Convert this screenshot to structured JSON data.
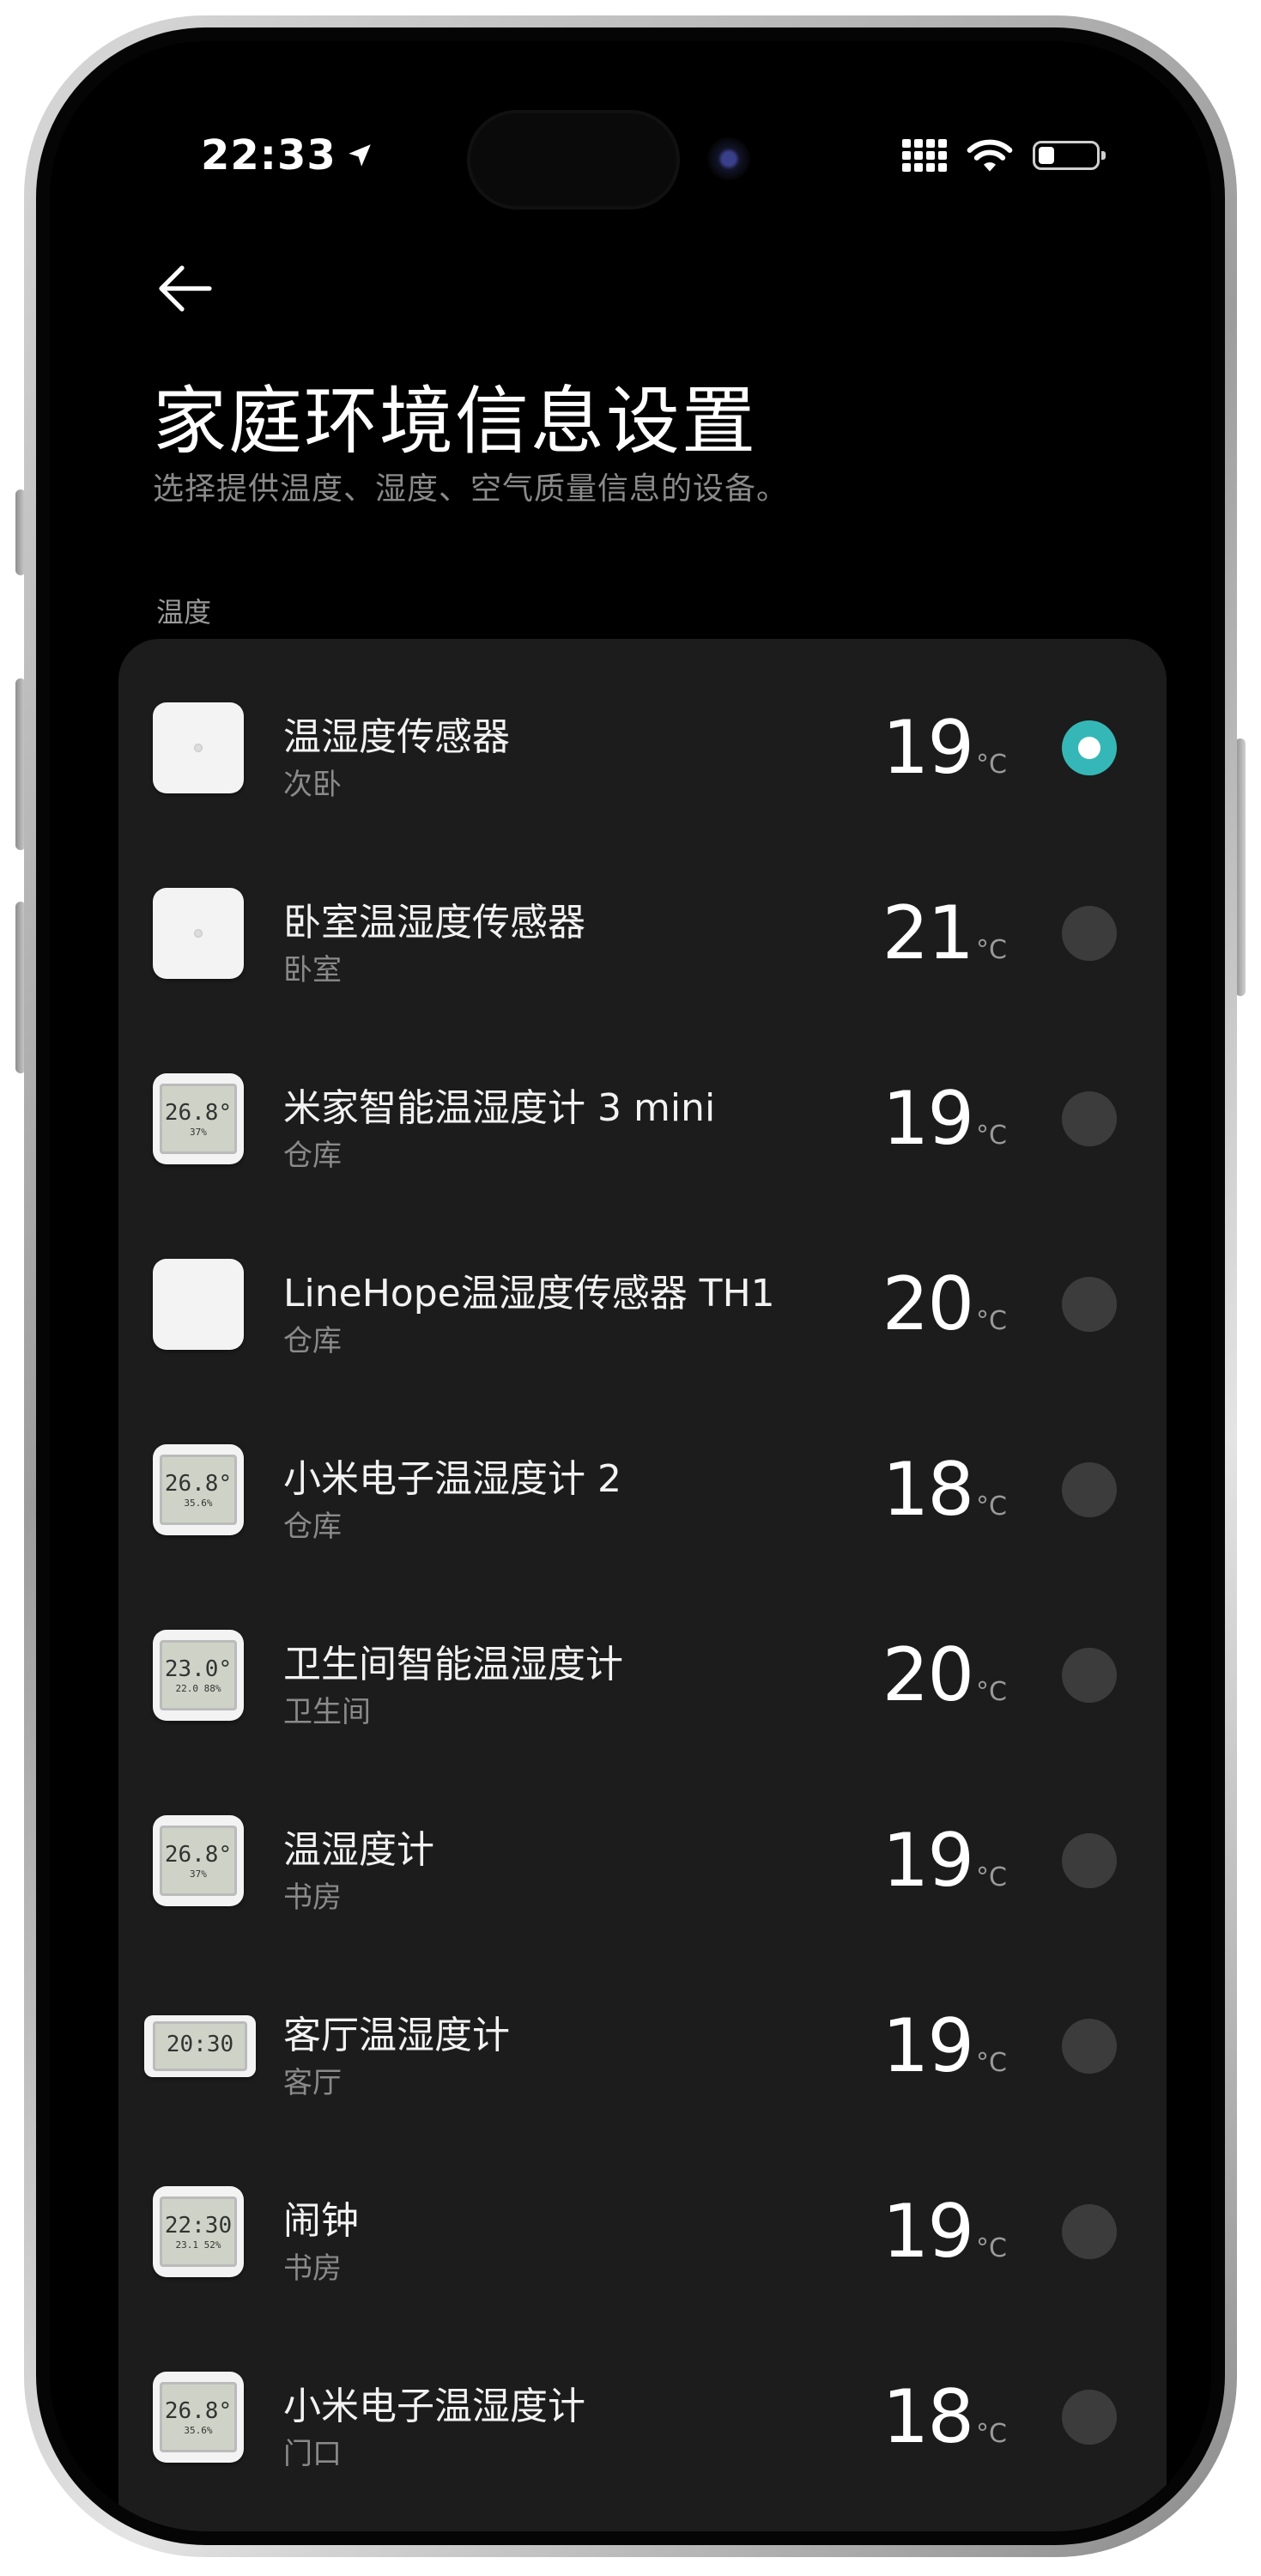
{
  "status": {
    "time": "22:33"
  },
  "header": {
    "title": "家庭环境信息设置",
    "subtitle": "选择提供温度、湿度、空气质量信息的设备。"
  },
  "section_label": "温度",
  "unit": "°C",
  "colors": {
    "accent": "#36b7b7",
    "card": "#1c1c1c",
    "background": "#000000"
  },
  "devices": [
    {
      "name": "温湿度传感器",
      "room": "次卧",
      "temp": "19",
      "selected": true,
      "icon": "square-sensor-icon"
    },
    {
      "name": "卧室温湿度传感器",
      "room": "卧室",
      "temp": "21",
      "selected": false,
      "icon": "square-sensor-icon"
    },
    {
      "name": "米家智能温湿度计 3 mini",
      "room": "仓库",
      "temp": "19",
      "selected": false,
      "icon": "lcd-thermometer-icon",
      "lcd": "26.8°",
      "lcd_sub": "37%"
    },
    {
      "name": "LineHope温湿度传感器 TH1",
      "room": "仓库",
      "temp": "20",
      "selected": false,
      "icon": "blank-sensor-icon"
    },
    {
      "name": "小米电子温湿度计 2",
      "room": "仓库",
      "temp": "18",
      "selected": false,
      "icon": "lcd-thermometer-icon",
      "lcd": "26.8°",
      "lcd_sub": "35.6%"
    },
    {
      "name": "卫生间智能温湿度计",
      "room": "卫生间",
      "temp": "20",
      "selected": false,
      "icon": "lcd-thermometer-icon",
      "lcd": "23.0°",
      "lcd_sub": "22.0  88%"
    },
    {
      "name": "温湿度计",
      "room": "书房",
      "temp": "19",
      "selected": false,
      "icon": "lcd-thermometer-icon",
      "lcd": "26.8°",
      "lcd_sub": "37%"
    },
    {
      "name": "客厅温湿度计",
      "room": "客厅",
      "temp": "19",
      "selected": false,
      "icon": "lcd-clock-icon",
      "lcd": "20:30",
      "lcd_sub": ""
    },
    {
      "name": "闹钟",
      "room": "书房",
      "temp": "19",
      "selected": false,
      "icon": "alarm-clock-icon",
      "lcd": "22:30",
      "lcd_sub": "23.1  52%"
    },
    {
      "name": "小米电子温湿度计",
      "room": "门口",
      "temp": "18",
      "selected": false,
      "icon": "lcd-thermometer-icon",
      "lcd": "26.8°",
      "lcd_sub": "35.6%"
    }
  ]
}
